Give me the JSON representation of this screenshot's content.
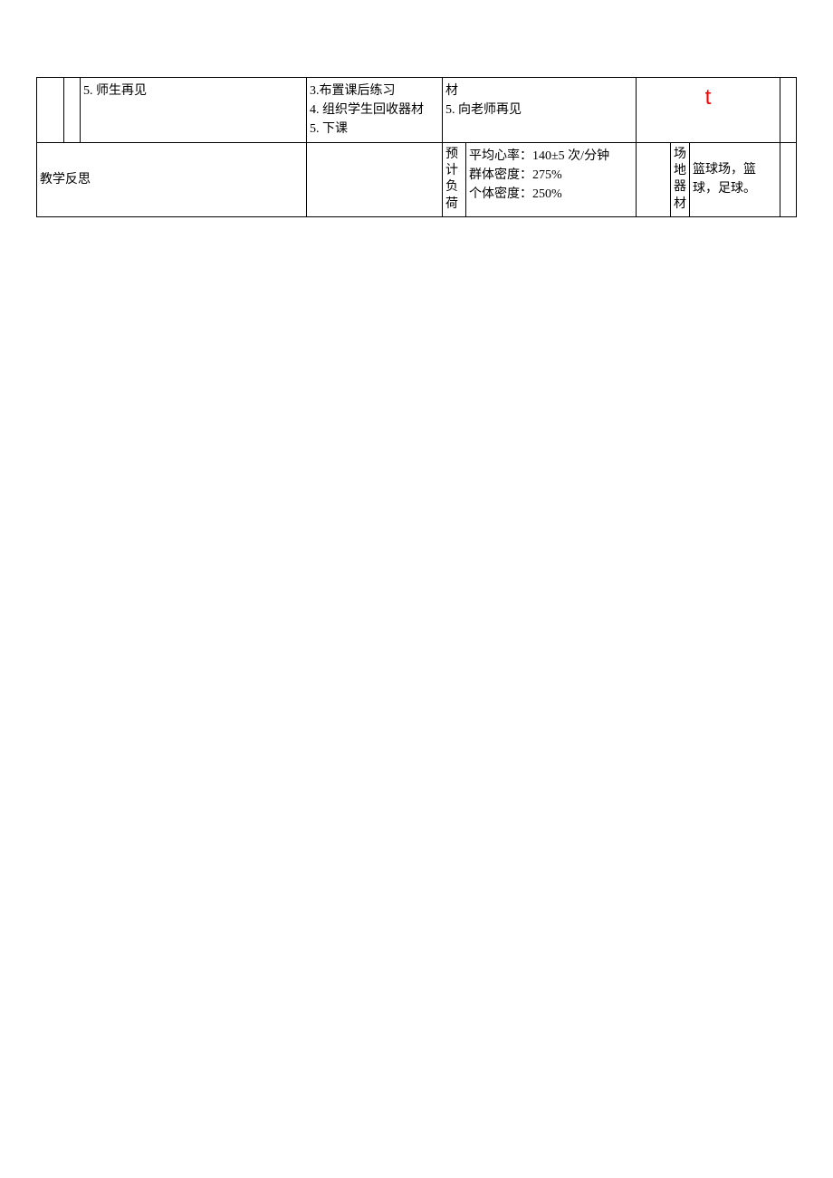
{
  "row1": {
    "c1": "",
    "c2": "",
    "c3": "5. 师生再见",
    "c4": "3.布置课后练习\n4. 组织学生回收器材\n5. 下课",
    "c5": "材\n5. 向老师再见",
    "c7": "t",
    "c8": ""
  },
  "row2": {
    "label": "教学反思",
    "col2": "",
    "col3": "预计负荷",
    "col4_line1": "平均心率：140±5 次/分钟",
    "col4_line2": "群体密度：275%",
    "col4_line3": "个体密度：250%",
    "col5": "",
    "col6": "场地器材",
    "col7": "篮球场，篮球，足球。",
    "col8": ""
  }
}
